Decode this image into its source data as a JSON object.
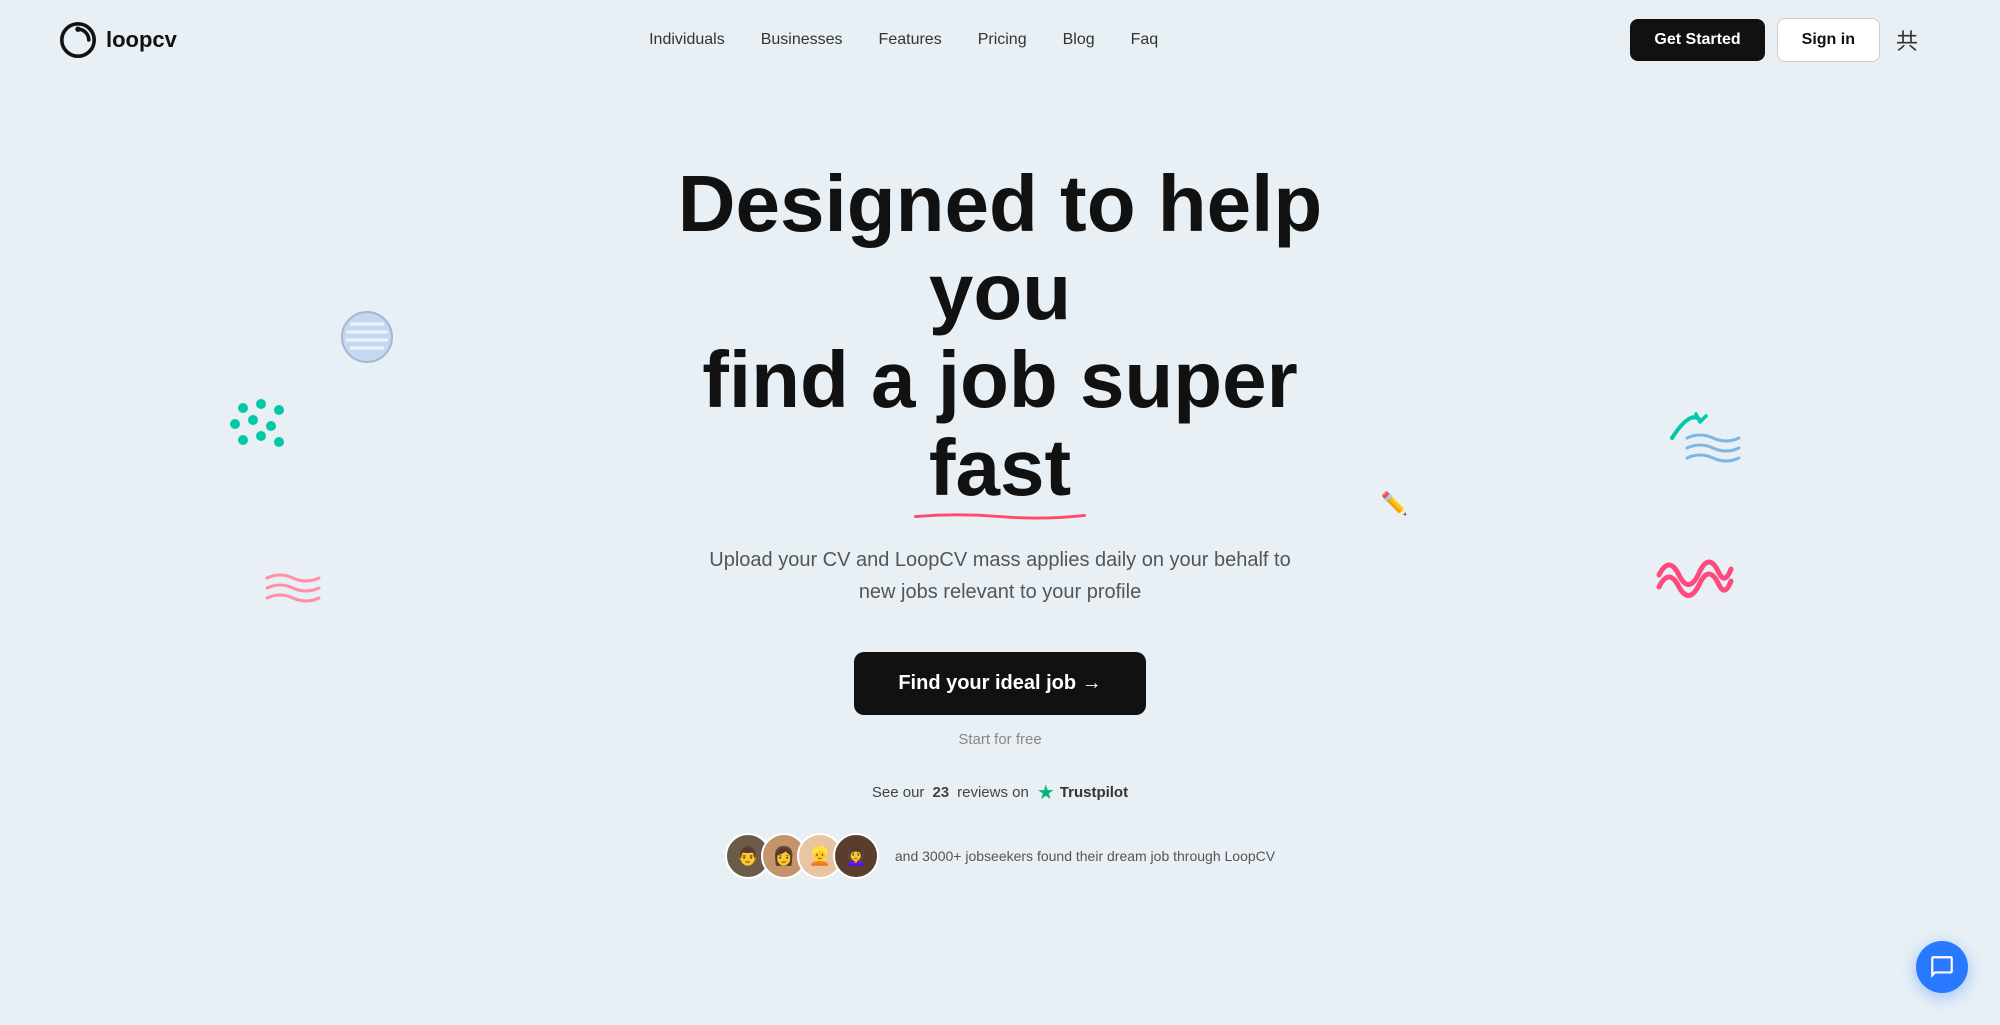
{
  "nav": {
    "logo_text": "loopcv",
    "links": [
      {
        "label": "Individuals",
        "id": "individuals"
      },
      {
        "label": "Businesses",
        "id": "businesses"
      },
      {
        "label": "Features",
        "id": "features"
      },
      {
        "label": "Pricing",
        "id": "pricing"
      },
      {
        "label": "Blog",
        "id": "blog"
      },
      {
        "label": "Faq",
        "id": "faq"
      }
    ],
    "get_started": "Get Started",
    "sign_in": "Sign in"
  },
  "hero": {
    "title_line1": "Designed to help you",
    "title_line2": "find a job super fast",
    "subtitle": "Upload your CV and LoopCV mass applies daily on your behalf to new jobs relevant to your profile",
    "cta_label": "Find your ideal job →",
    "start_free": "Start for free",
    "trustpilot_text": "See our",
    "trustpilot_count": "23",
    "trustpilot_suffix": "reviews on",
    "trustpilot_brand": "Trustpilot",
    "social_proof_text": "and 3000+ jobseekers found their dream job through LoopCV"
  },
  "colors": {
    "bg": "#e8f0f5",
    "cta_bg": "#111111",
    "accent_red": "#ff4a6e",
    "accent_teal": "#00b89e",
    "accent_blue": "#2979ff",
    "accent_pink": "#ff6b9d"
  }
}
